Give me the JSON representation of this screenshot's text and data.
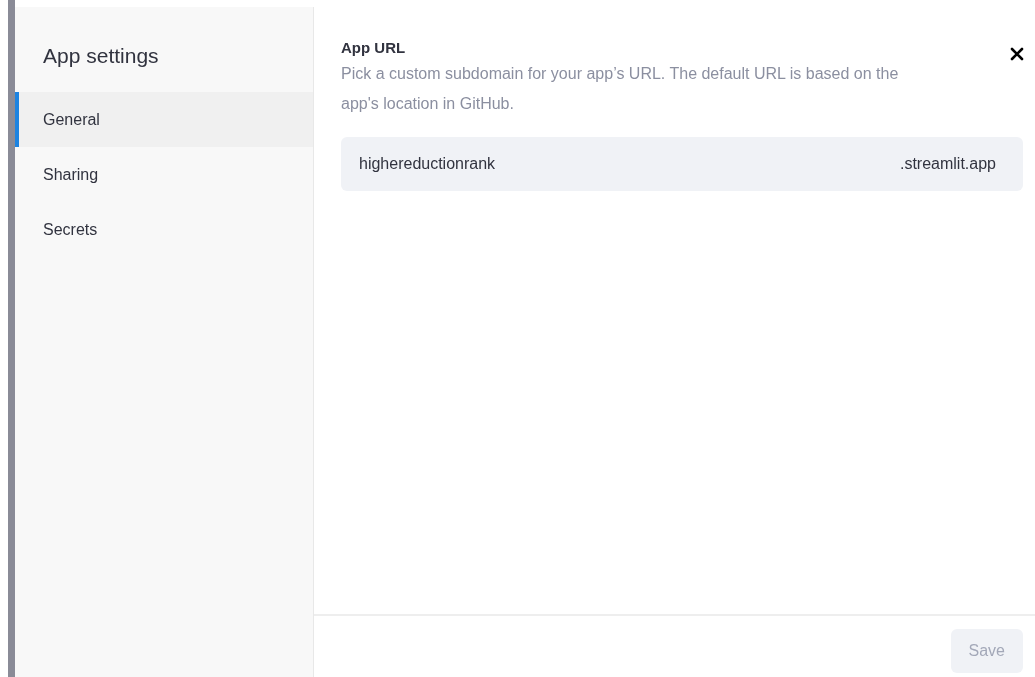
{
  "sidebar": {
    "title": "App settings",
    "items": [
      {
        "label": "General",
        "selected": true
      },
      {
        "label": "Sharing",
        "selected": false
      },
      {
        "label": "Secrets",
        "selected": false
      }
    ]
  },
  "section": {
    "title": "App URL",
    "description": "Pick a custom subdomain for your app’s URL. The default URL is based on the app's location in GitHub.",
    "field": {
      "value": "highereductionrank",
      "suffix": ".streamlit.app"
    }
  },
  "footer": {
    "buttons": [
      {
        "label": "Save",
        "disabled": true
      }
    ]
  }
}
